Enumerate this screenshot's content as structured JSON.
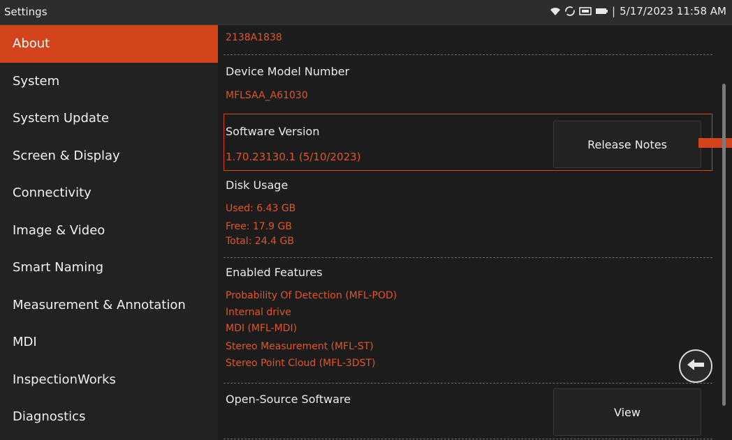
{
  "window": {
    "title": "Settings"
  },
  "status": {
    "datetime": "5/17/2023 11:58 AM",
    "separator": "|"
  },
  "icons": [
    "wifi-icon",
    "sync-icon",
    "storage-card-icon",
    "battery-icon",
    "back-arrow-icon"
  ],
  "colors": {
    "accent": "#d4441c",
    "value_text": "#e0552a"
  },
  "sidebar": {
    "items": [
      {
        "label": "About",
        "active": true
      },
      {
        "label": "System"
      },
      {
        "label": "System Update"
      },
      {
        "label": "Screen & Display"
      },
      {
        "label": "Connectivity"
      },
      {
        "label": "Image & Video"
      },
      {
        "label": "Smart Naming"
      },
      {
        "label": "Measurement & Annotation"
      },
      {
        "label": "MDI"
      },
      {
        "label": "InspectionWorks"
      },
      {
        "label": "Diagnostics"
      }
    ]
  },
  "about": {
    "serial_value": "2138A1838",
    "device_model": {
      "label": "Device Model Number",
      "value": "MFLSAA_A61030"
    },
    "software_version": {
      "label": "Software Version",
      "value": "1.70.23130.1 (5/10/2023)",
      "button": "Release Notes"
    },
    "disk_usage": {
      "label": "Disk Usage",
      "used": "Used: 6.43 GB",
      "free": "Free: 17.9 GB",
      "total": "Total: 24.4 GB"
    },
    "enabled_features": {
      "label": "Enabled Features",
      "items": [
        "Probability Of Detection (MFL-POD)",
        "Internal drive",
        "MDI (MFL-MDI)",
        "Stereo Measurement (MFL-ST)",
        "Stereo Point Cloud (MFL-3DST)"
      ]
    },
    "open_source": {
      "label": "Open-Source Software",
      "button": "View"
    }
  }
}
